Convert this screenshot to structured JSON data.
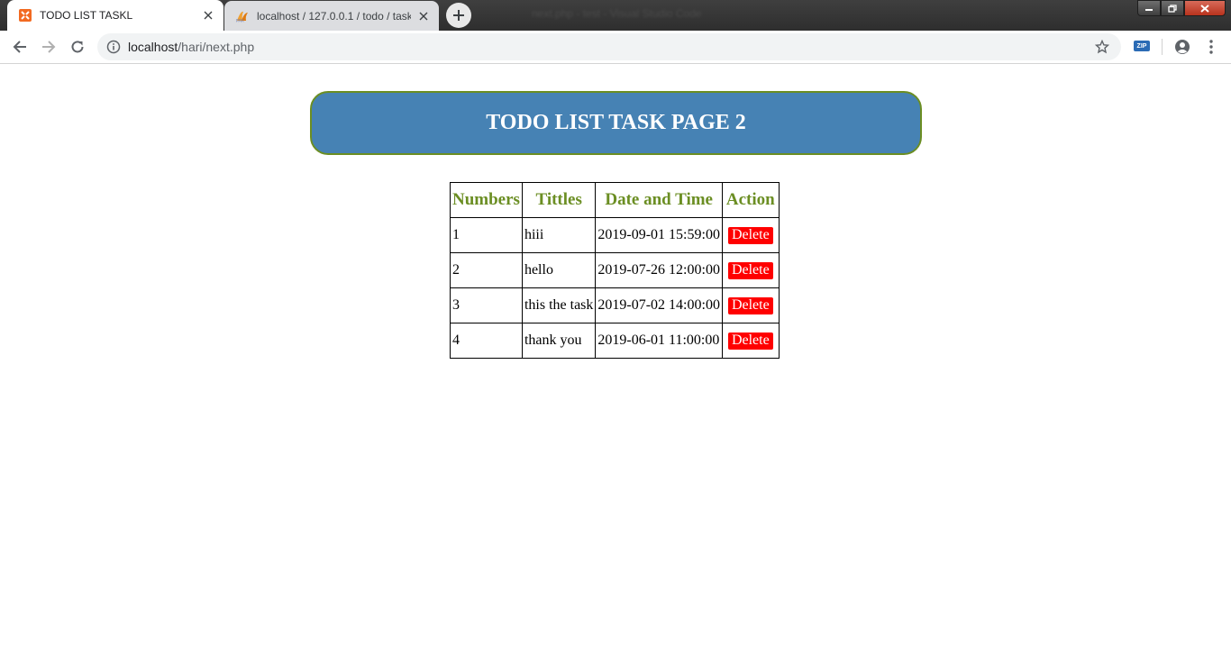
{
  "browser": {
    "tabs": [
      {
        "title": "TODO LIST TASKL",
        "favicon": "xampp-icon",
        "active": true
      },
      {
        "title": "localhost / 127.0.0.1 / todo / task",
        "favicon": "phpmyadmin-icon",
        "active": false
      }
    ],
    "window_title": "next.php - test - Visual Studio Code",
    "url_host": "localhost",
    "url_path": "/hari/next.php",
    "extension_label": "ZIP"
  },
  "page": {
    "heading": "TODO LIST TASK PAGE 2",
    "colors": {
      "header_bg": "#4682b4",
      "header_border": "#6b8e23",
      "column_header_text": "#6b8e23",
      "delete_button": "#ff0000"
    },
    "table": {
      "headers": [
        "Numbers",
        "Tittles",
        "Date and Time",
        "Action"
      ],
      "rows": [
        {
          "number": "1",
          "title": "hiii",
          "datetime": "2019-09-01 15:59:00",
          "action": "Delete"
        },
        {
          "number": "2",
          "title": "hello",
          "datetime": "2019-07-26 12:00:00",
          "action": "Delete"
        },
        {
          "number": "3",
          "title": "this the task",
          "datetime": "2019-07-02 14:00:00",
          "action": "Delete"
        },
        {
          "number": "4",
          "title": "thank you",
          "datetime": "2019-06-01 11:00:00",
          "action": "Delete"
        }
      ]
    }
  }
}
